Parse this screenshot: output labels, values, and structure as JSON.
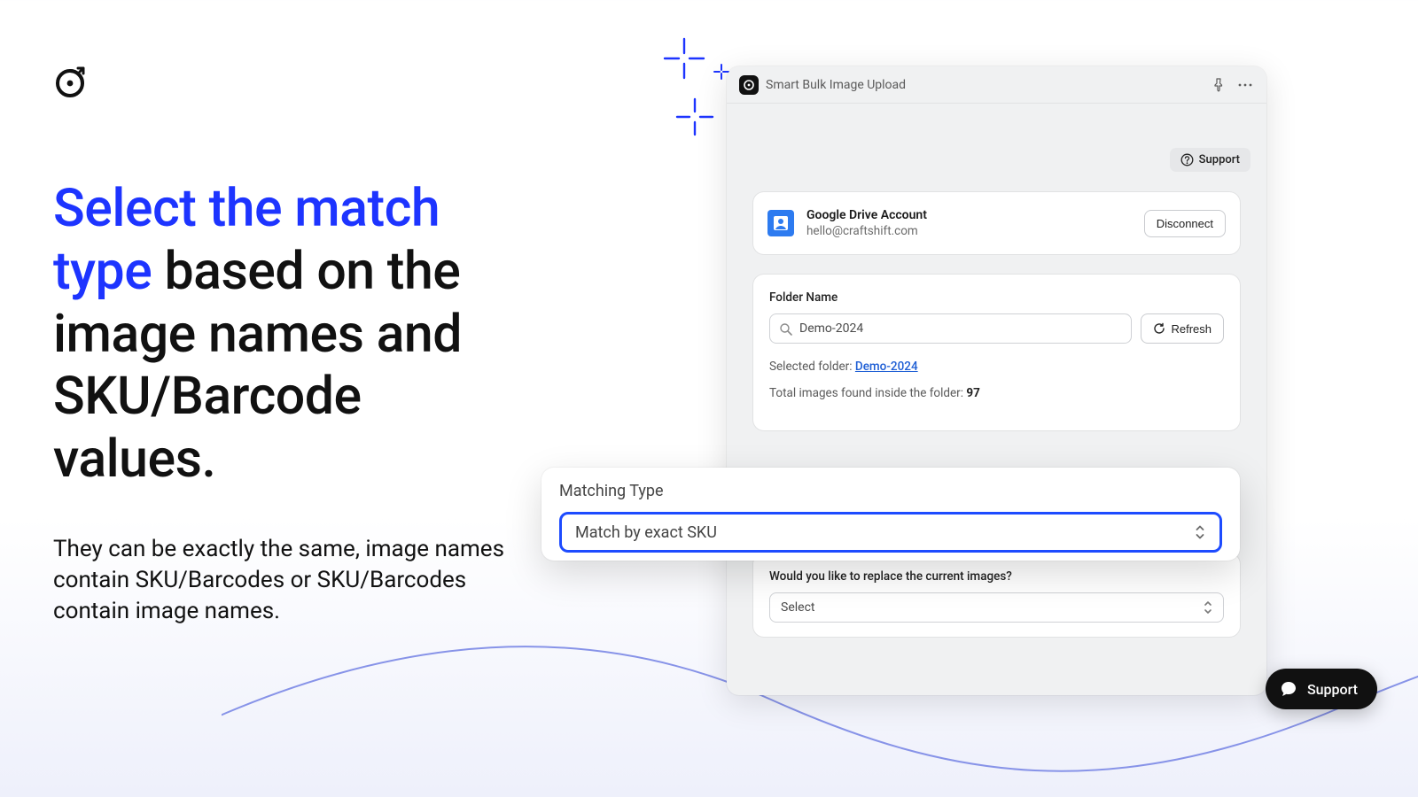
{
  "marketing": {
    "headline_accent": "Select the match type",
    "headline_rest": " based on the image names and SKU/Barcode values.",
    "subtext": "They can be exactly the same, image names contain SKU/Barcodes or SKU/Barcodes contain image names."
  },
  "window": {
    "title": "Smart Bulk Image Upload",
    "support_label": "Support"
  },
  "account": {
    "title": "Google Drive Account",
    "email": "hello@craftshift.com",
    "disconnect_label": "Disconnect"
  },
  "folder": {
    "label": "Folder Name",
    "value": "Demo-2024",
    "refresh_label": "Refresh",
    "selected_prefix": "Selected folder: ",
    "selected_link": "Demo-2024",
    "count_prefix": "Total images found inside the folder: ",
    "count": "97"
  },
  "matching": {
    "label": "Matching Type",
    "value": "Match by exact SKU"
  },
  "replace": {
    "label": "Would you like to replace the current images?",
    "value": "Select"
  },
  "support_chip": {
    "label": "Support"
  }
}
